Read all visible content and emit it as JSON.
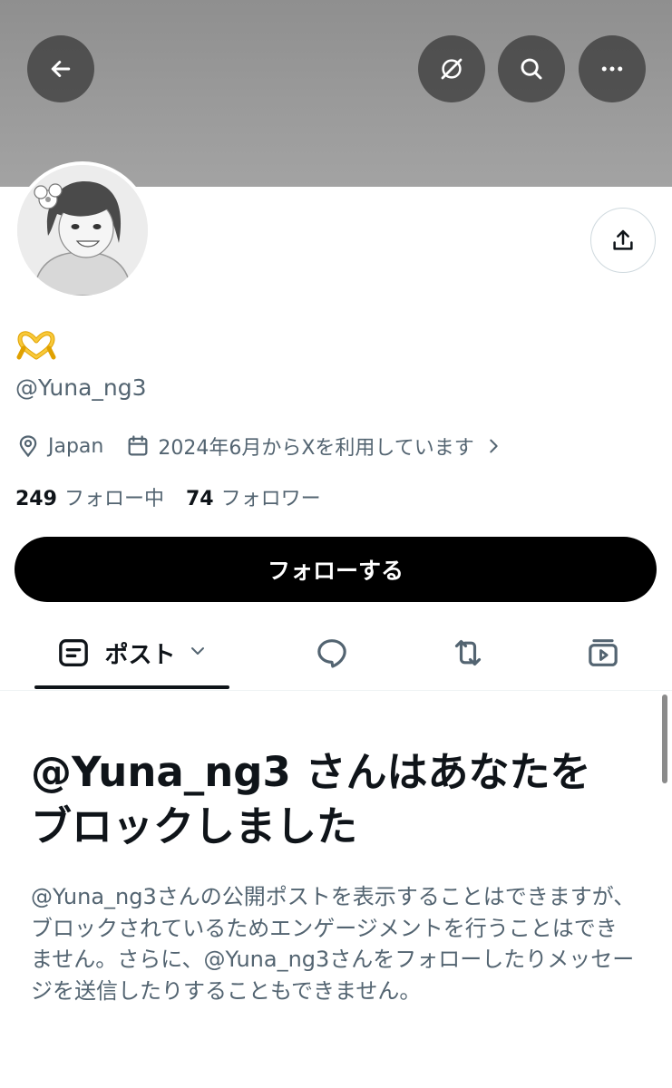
{
  "header": {
    "back_icon": "arrow-left-icon",
    "grok_icon": "grok-icon",
    "search_icon": "search-icon",
    "more_icon": "more-horizontal-icon"
  },
  "profile": {
    "display_name_emoji": "heart-hands-emoji",
    "handle": "@Yuna_ng3",
    "location": "Japan",
    "joined": "2024年6月からXを利用しています",
    "following_count": "249",
    "following_label": "フォロー中",
    "followers_count": "74",
    "followers_label": "フォロワー",
    "follow_button": "フォローする"
  },
  "tabs": {
    "posts_label": "ポスト",
    "posts_icon": "posts-icon",
    "replies_icon": "reply-icon",
    "reposts_icon": "repost-icon",
    "media_icon": "media-icon"
  },
  "blocked": {
    "title": "@Yuna_ng3 さんはあなたをブロックしました",
    "description": "@Yuna_ng3さんの公開ポストを表示することはできますが、ブロックされているためエンゲージメントを行うことはできません。さらに、@Yuna_ng3さんをフォローしたりメッセージを送信したりすることもできません。"
  },
  "colors": {
    "banner": "#9a9a9a",
    "follow_button_bg": "#000000",
    "secondary_text": "#536471",
    "emoji_gold": "#f4b400"
  }
}
